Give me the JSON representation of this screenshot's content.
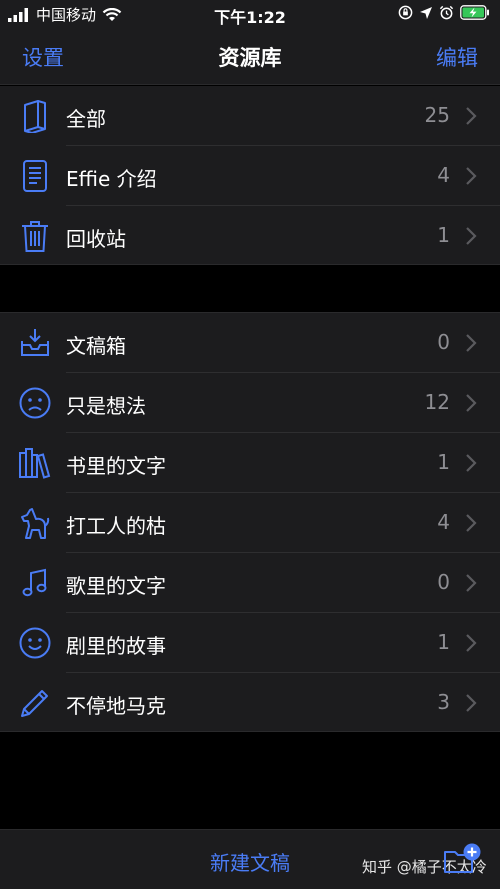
{
  "status_bar": {
    "carrier": "中国移动",
    "time": "下午1:22"
  },
  "nav": {
    "left": "设置",
    "title": "资源库",
    "right": "编辑"
  },
  "group1": [
    {
      "label": "全部",
      "count": "25",
      "icon": "book-icon"
    },
    {
      "label": "Effie 介绍",
      "count": "4",
      "icon": "document-icon"
    },
    {
      "label": "回收站",
      "count": "1",
      "icon": "trash-icon"
    }
  ],
  "group2": [
    {
      "label": "文稿箱",
      "count": "0",
      "icon": "inbox-icon"
    },
    {
      "label": "只是想法",
      "count": "12",
      "icon": "sad-face-icon"
    },
    {
      "label": "书里的文字",
      "count": "1",
      "icon": "books-icon"
    },
    {
      "label": "打工人的枯",
      "count": "4",
      "icon": "dog-icon"
    },
    {
      "label": "歌里的文字",
      "count": "0",
      "icon": "music-note-icon"
    },
    {
      "label": "剧里的故事",
      "count": "1",
      "icon": "smile-face-icon"
    },
    {
      "label": "不停地马克",
      "count": "3",
      "icon": "pencil-icon"
    }
  ],
  "bottom": {
    "new_draft": "新建文稿",
    "watermark": "知乎 @橘子不太冷"
  },
  "colors": {
    "accent": "#4a7cf5",
    "background": "#000000",
    "surface": "#1c1c1e",
    "secondary_text": "#8e8e93"
  }
}
